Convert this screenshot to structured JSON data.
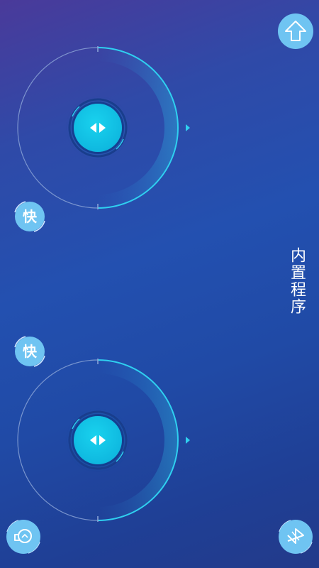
{
  "controls": {
    "fast_top_label": "快",
    "fast_bottom_label": "快",
    "builtin_program_label": "内置程序"
  },
  "icons": {
    "up": "up-arrow-icon",
    "light": "lightbulb-icon",
    "bluetooth": "bluetooth-icon",
    "knob": "left-right-arrows-icon"
  },
  "colors": {
    "accent": "#19d2ee",
    "button": "#6fc4f2",
    "ring": "#2fd0f0"
  }
}
